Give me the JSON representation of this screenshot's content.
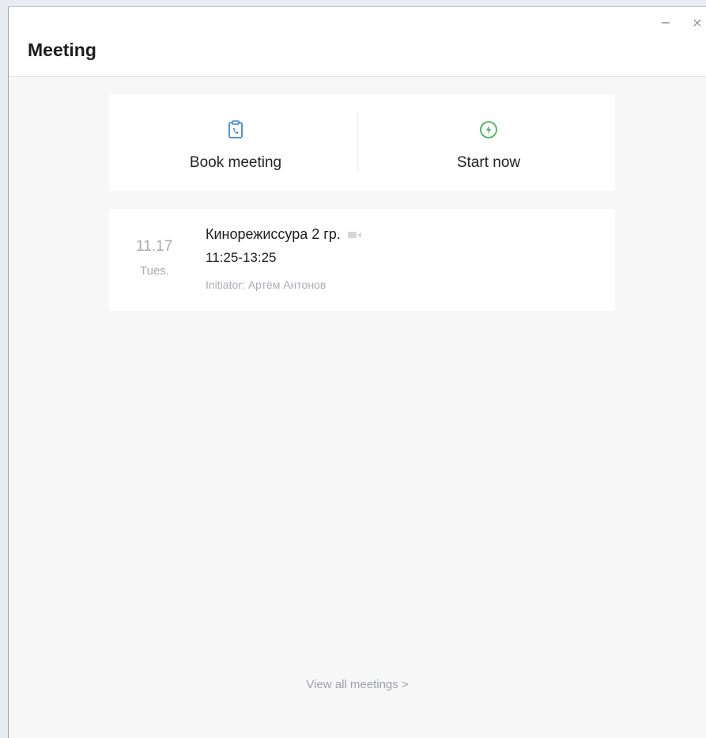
{
  "window": {
    "title": "Meeting",
    "minimize_glyph": "−",
    "close_glyph": "×"
  },
  "actions": {
    "book": {
      "label": "Book meeting",
      "icon": "clipboard-phone-icon"
    },
    "start": {
      "label": "Start now",
      "icon": "lightning-circle-icon"
    }
  },
  "meetings": [
    {
      "date": "11.17",
      "day": "Tues.",
      "title": "Кинорежиссура 2 гр.",
      "type_icon": "video-camera-icon",
      "time": "11:25-13:25",
      "initiator": "Initiator: Артём Антонов"
    }
  ],
  "footer": {
    "view_all_label": "View all meetings >"
  },
  "colors": {
    "book_icon": "#3d86d8",
    "start_icon": "#45b35a",
    "muted_text": "#a6a9ae",
    "background": "#f7f7f8"
  }
}
